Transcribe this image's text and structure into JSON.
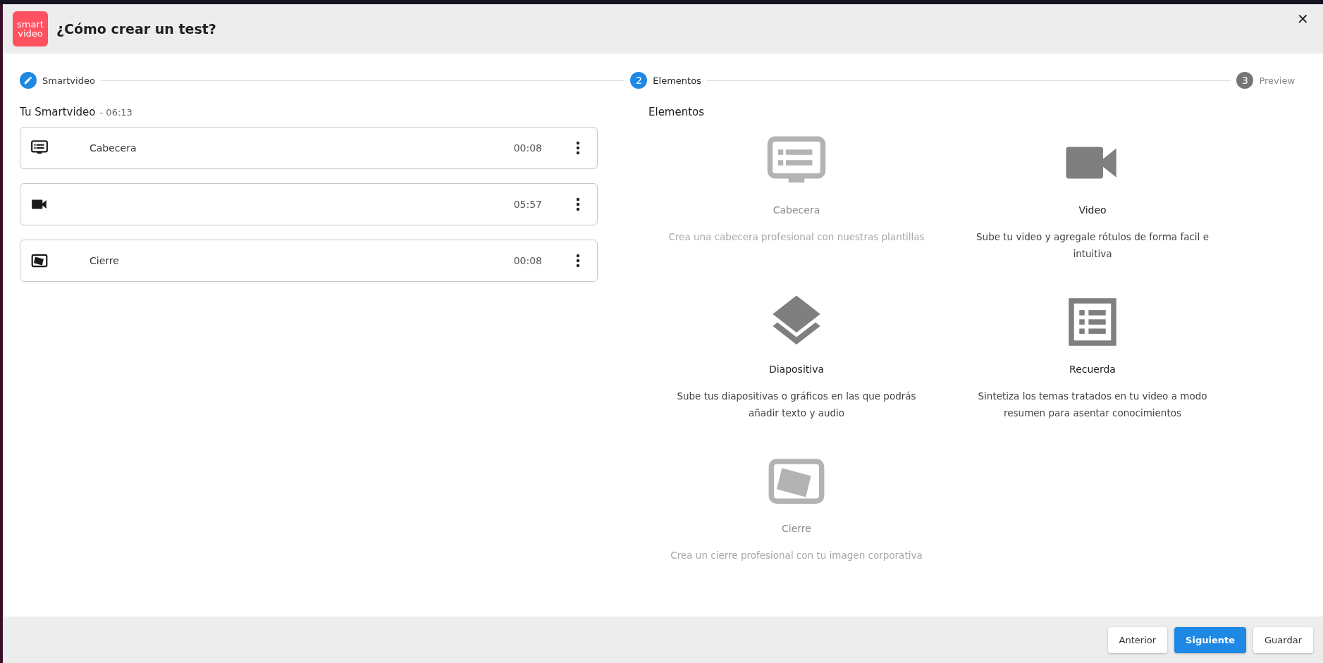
{
  "dialog": {
    "logo_lines": [
      "smart",
      "video"
    ],
    "title": "¿Cómo crear un test?",
    "close": "✕"
  },
  "steps": [
    {
      "label": "Smartvideo",
      "completed": true,
      "selected": false
    },
    {
      "label": "Elementos",
      "number": "2",
      "completed": false,
      "selected": true
    },
    {
      "label": "Preview",
      "number": "3",
      "completed": false,
      "selected": false
    }
  ],
  "timeline": {
    "title": "Tu Smartvideo",
    "separator": "-",
    "total": "06:13",
    "items": [
      {
        "kind": "header",
        "name": "Cabecera",
        "duration": "00:08"
      },
      {
        "kind": "video",
        "duration": "05:57"
      },
      {
        "kind": "closing",
        "name": "Cierre",
        "duration": "00:08"
      }
    ]
  },
  "elements": {
    "title": "Elementos",
    "items": [
      {
        "kind": "header",
        "name": "Cabecera",
        "description": "Crea una cabecera profesional con nuestras plantillas",
        "disabled": true
      },
      {
        "kind": "video",
        "name": "Video",
        "description": "Sube tu video y agregale rótulos de forma facil e intuitiva",
        "disabled": false
      },
      {
        "kind": "slide",
        "name": "Diapositiva",
        "description": "Sube tus diapositivas o gráficos en las que podrás añadir texto y audio",
        "disabled": false
      },
      {
        "kind": "summary",
        "name": "Recuerda",
        "description": "Sintetiza los temas tratados en tu video a modo resumen para asentar conocimientos",
        "disabled": false
      },
      {
        "kind": "closing",
        "name": "Cierre",
        "description": "Crea un cierre profesional con tu imagen corporativa",
        "disabled": true
      }
    ]
  },
  "footer": {
    "buttons": [
      {
        "label": "Anterior",
        "primary": false
      },
      {
        "label": "Siguiente",
        "primary": true
      },
      {
        "label": "Guardar",
        "primary": false
      }
    ]
  }
}
